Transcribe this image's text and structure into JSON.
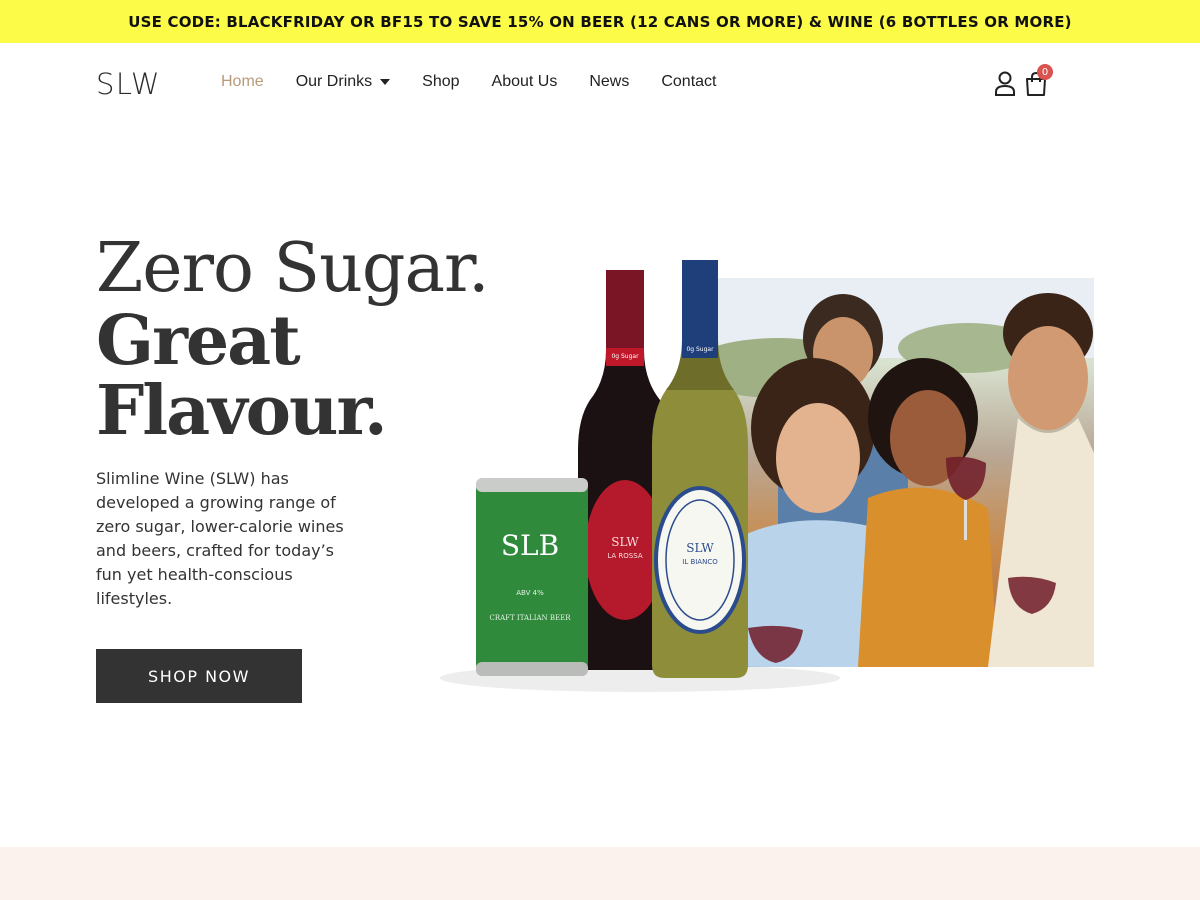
{
  "promo": {
    "text": "USE CODE: BLACKFRIDAY OR BF15 TO SAVE 15% ON BEER (12 CANS OR MORE) & WINE (6 BOTTLES OR MORE)",
    "background": "#fbfb48"
  },
  "header": {
    "logo": "SLW",
    "nav": [
      {
        "label": "Home",
        "active": true
      },
      {
        "label": "Our Drinks",
        "has_dropdown": true
      },
      {
        "label": "Shop"
      },
      {
        "label": "About Us"
      },
      {
        "label": "News"
      },
      {
        "label": "Contact"
      }
    ],
    "cart_count": "0",
    "icons": [
      "user-icon",
      "cart-icon"
    ]
  },
  "hero": {
    "line1": "Zero Sugar.",
    "line2": "Great",
    "line3": "Flavour.",
    "description": "Slimline Wine (SLW) has developed a growing range of zero sugar, lower-calorie wines and beers, crafted for today’s fun yet health-conscious lifestyles.",
    "cta": "SHOP NOW"
  },
  "products": {
    "can": {
      "brand": "SLB",
      "sub": "CRAFT ITALIAN BEER",
      "abv": "ABV 4%"
    },
    "red_bottle": {
      "brand": "SLW",
      "name": "LA ROSSA",
      "neck": "0g Sugar"
    },
    "white_bottle": {
      "brand": "SLW",
      "name": "IL BIANCO",
      "neck": "0g Sugar"
    }
  },
  "colors": {
    "accent_active_nav": "#b89a7a",
    "button": "#333333",
    "badge": "#d9534f",
    "bottom_band": "#fbf1ed"
  }
}
